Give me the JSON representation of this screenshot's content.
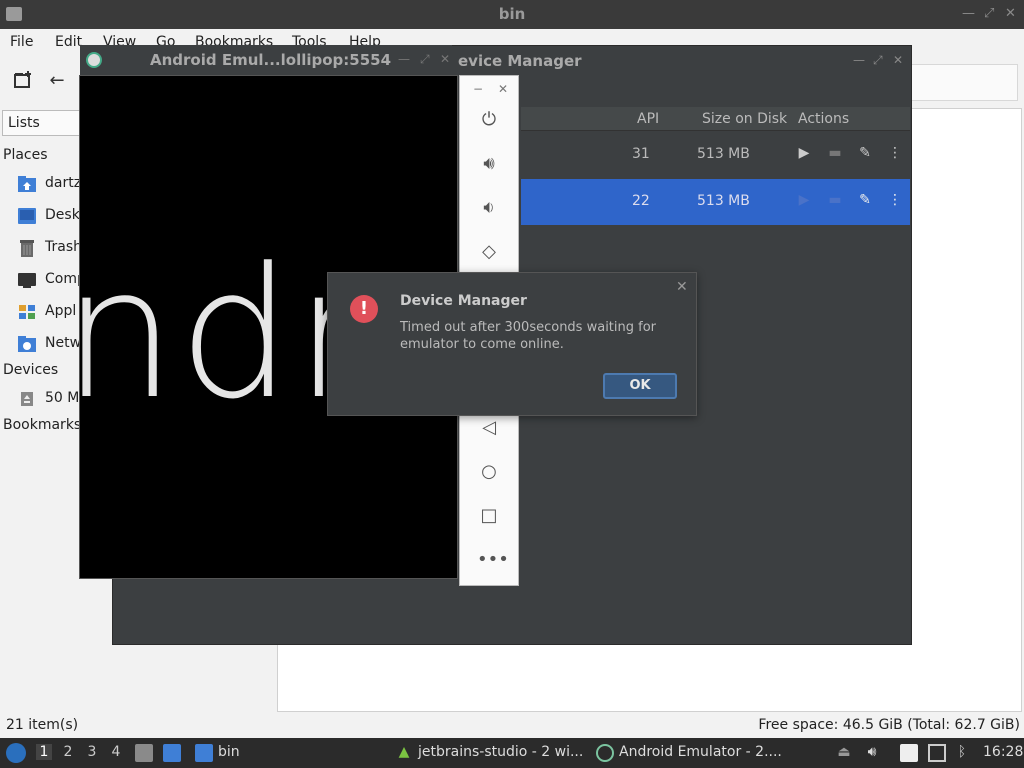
{
  "file_manager": {
    "title": "bin",
    "menu": [
      "File",
      "Edit",
      "View",
      "Go",
      "Bookmarks",
      "Tools",
      "Help"
    ],
    "side_pane_mode": "Lists",
    "places_label": "Places",
    "places": [
      "dartz",
      "Desk",
      "Trash",
      "Comp",
      "Appl",
      "Netw"
    ],
    "devices_label": "Devices",
    "devices": [
      "50 M"
    ],
    "bookmarks_label": "Bookmarks",
    "status_items": "21 item(s)",
    "status_space": "Free space: 46.5 GiB (Total: 62.7 GiB)"
  },
  "device_manager": {
    "title": "evice Manager",
    "columns": {
      "api": "API",
      "size": "Size on Disk",
      "actions": "Actions"
    },
    "rows": [
      {
        "api": "31",
        "size": "513 MB",
        "selected": false
      },
      {
        "api": "22",
        "size": "513 MB",
        "selected": true
      }
    ]
  },
  "emulator": {
    "title": "Android Emul...lollipop:5554",
    "boot_text": "ndr"
  },
  "dialog": {
    "title": "Device Manager",
    "message": "Timed out after 300seconds waiting for emulator to come online.",
    "ok_label": "OK"
  },
  "taskbar": {
    "workspaces": [
      "1",
      "2",
      "3",
      "4"
    ],
    "bin_label": "bin",
    "task1": "jetbrains-studio - 2 wi...",
    "task2": "Android Emulator - 2....",
    "clock": "16:28"
  },
  "colors": {
    "selection": "#2f65ca",
    "dark_window": "#3c3f41",
    "error": "#e0505a"
  }
}
